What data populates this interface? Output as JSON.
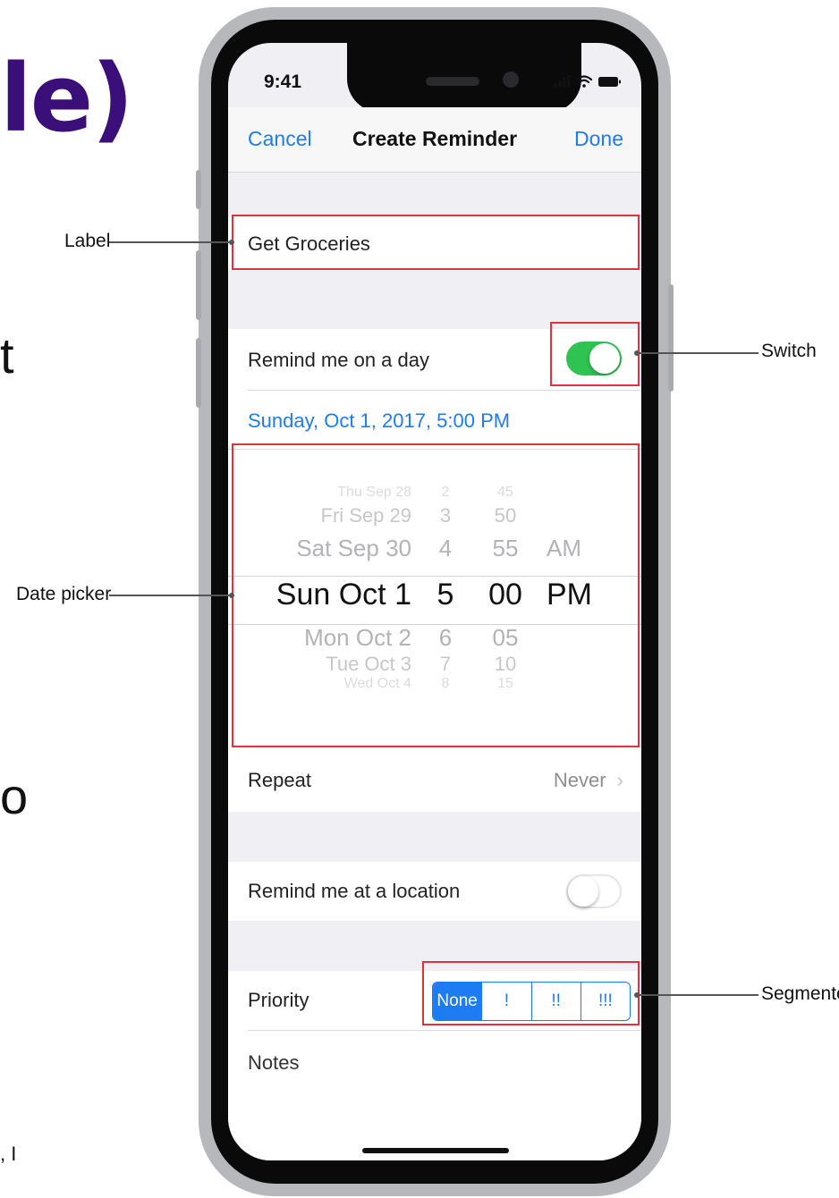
{
  "slide": {
    "title_fragment": "le)",
    "fragment_t": "t",
    "fragment_o": "o",
    "footer_fragment": ", I"
  },
  "status_bar": {
    "time": "9:41",
    "icons": [
      "signal-icon",
      "wifi-icon",
      "battery-icon"
    ]
  },
  "nav": {
    "cancel_label": "Cancel",
    "title": "Create Reminder",
    "done_label": "Done"
  },
  "reminder": {
    "title_value": "Get Groceries",
    "remind_day_label": "Remind me on a day",
    "remind_day_on": true,
    "date_display": "Sunday, Oct 1, 2017, 5:00 PM",
    "repeat_label": "Repeat",
    "repeat_value": "Never",
    "remind_location_label": "Remind me at a location",
    "remind_location_on": false,
    "priority_label": "Priority",
    "priority_options": [
      "None",
      "!",
      "!!",
      "!!!"
    ],
    "priority_selected": "None",
    "notes_label": "Notes"
  },
  "date_picker": {
    "rows": [
      {
        "day": "Thu Sep 28",
        "hour": "2",
        "minute": "45",
        "ampm": ""
      },
      {
        "day": "Fri Sep 29",
        "hour": "3",
        "minute": "50",
        "ampm": ""
      },
      {
        "day": "Sat Sep 30",
        "hour": "4",
        "minute": "55",
        "ampm": "AM"
      },
      {
        "day": "Sun Oct 1",
        "hour": "5",
        "minute": "00",
        "ampm": "PM"
      },
      {
        "day": "Mon Oct 2",
        "hour": "6",
        "minute": "05",
        "ampm": ""
      },
      {
        "day": "Tue Oct 3",
        "hour": "7",
        "minute": "10",
        "ampm": ""
      },
      {
        "day": "Wed Oct 4",
        "hour": "8",
        "minute": "15",
        "ampm": ""
      }
    ],
    "selected_index": 3
  },
  "annotations": {
    "label": "Label",
    "switch": "Switch",
    "date_picker": "Date picker",
    "segmented": "Segmente"
  },
  "colors": {
    "accent": "#1e7cf2",
    "toggle_on": "#2fc352",
    "highlight": "#e2313f",
    "title": "#3a0f7a"
  }
}
